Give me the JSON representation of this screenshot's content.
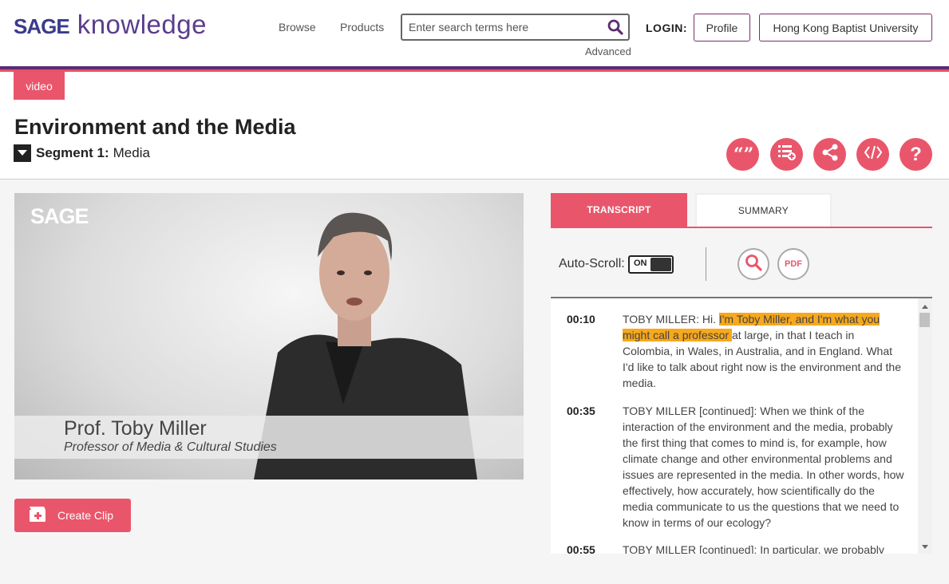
{
  "header": {
    "logo_mark": "SAGE",
    "logo_text": "knowledge",
    "nav": [
      "Browse",
      "Products"
    ],
    "search_placeholder": "Enter search terms here",
    "advanced": "Advanced",
    "login_label": "LOGIN:",
    "profile_button": "Profile",
    "institution_button": "Hong Kong Baptist University"
  },
  "page": {
    "type_tag": "video",
    "title": "Environment and the Media",
    "segment_label": "Segment 1:",
    "segment_name": "Media"
  },
  "actions": [
    "cite-icon",
    "add-to-list-icon",
    "share-icon",
    "embed-icon",
    "help-icon"
  ],
  "video": {
    "watermark": "SAGE",
    "lower_third_name": "Prof. Toby Miller",
    "lower_third_title": "Professor of Media & Cultural Studies"
  },
  "create_clip": "Create Clip",
  "tabs": {
    "transcript": "TRANSCRIPT",
    "summary": "SUMMARY"
  },
  "tools": {
    "autoscroll_label": "Auto-Scroll:",
    "autoscroll_state": "ON",
    "pdf_label": "PDF"
  },
  "transcript": [
    {
      "time": "00:10",
      "pre": "TOBY MILLER: Hi. ",
      "highlight": "I'm Toby Miller, and I'm what you might call a professor ",
      "post": "at large, in that I teach in Colombia, in Wales, in Australia, and in England. What I'd like to talk about right now is the environment and the media."
    },
    {
      "time": "00:35",
      "pre": "TOBY MILLER [continued]: When we think of the interaction of the environment and the media, probably the first thing that comes to mind is, for example, how climate change and other environmental problems and issues are represented in the media. In other words, how effectively, how accurately, how scientifically do the media communicate to us the questions that we need to know in terms of our ecology?",
      "highlight": "",
      "post": ""
    },
    {
      "time": "00:55",
      "pre": "TOBY MILLER [continued]: In particular, we probably",
      "highlight": "",
      "post": ""
    }
  ],
  "colors": {
    "brand_purple": "#5b2d6f",
    "accent_pink": "#e9566b",
    "highlight": "#f7a81b"
  }
}
